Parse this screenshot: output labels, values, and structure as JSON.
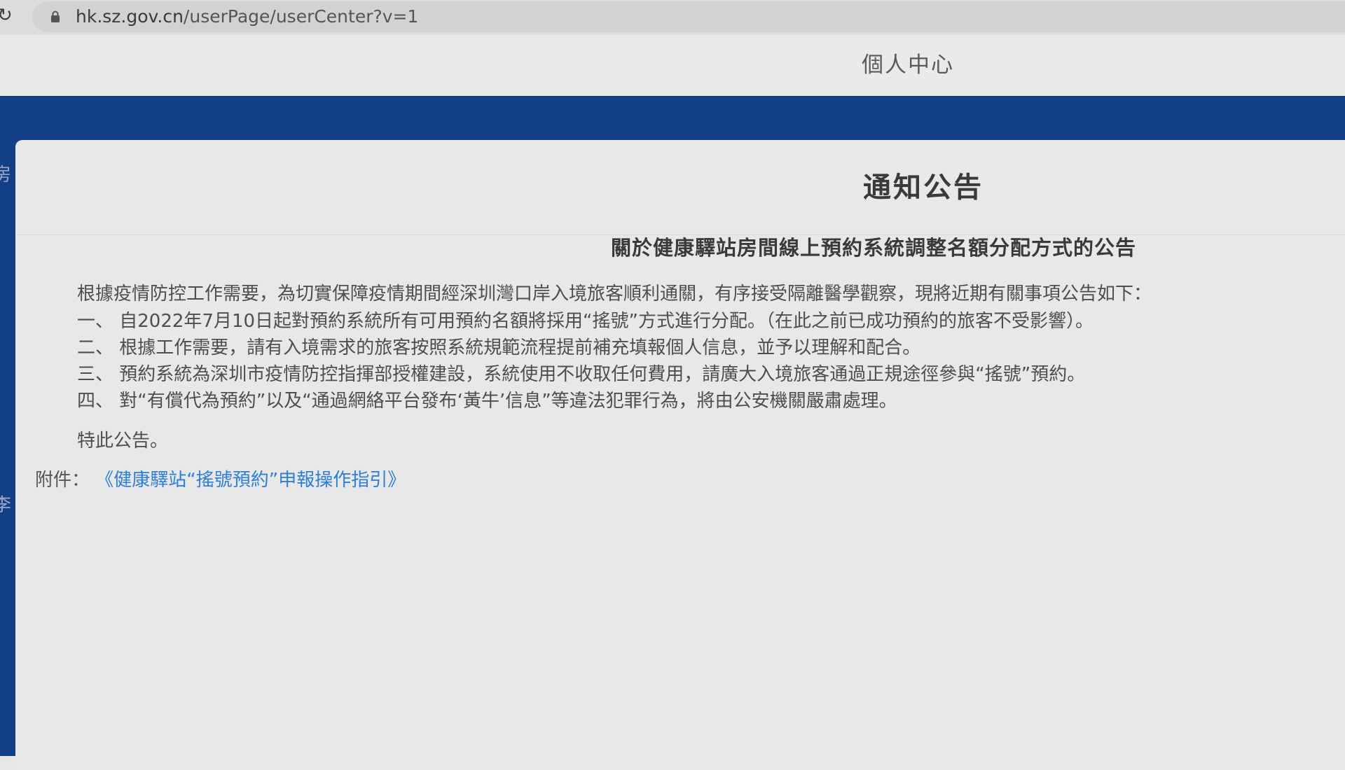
{
  "browser": {
    "url_host": "hk.sz.gov.cn",
    "url_path": "/userPage/userCenter?v=1"
  },
  "header": {
    "title": "個人中心"
  },
  "sidebar": {
    "partial_chars": [
      "房",
      "李"
    ]
  },
  "notice": {
    "section_title": "通知公告",
    "heading": "關於健康驛站房間線上預約系統調整名額分配方式的公告",
    "intro": "根據疫情防控工作需要，為切實保障疫情期間經深圳灣口岸入境旅客順利通關，有序接受隔離醫學觀察，現將近期有關事項公告如下：",
    "items": [
      "一、 自2022年7月10日起對預約系統所有可用預約名額將採用“搖號”方式進行分配。（在此之前已成功預約的旅客不受影響）。",
      "二、 根據工作需要，請有入境需求的旅客按照系統規範流程提前補充填報個人信息，並予以理解和配合。",
      "三、 預約系統為深圳市疫情防控指揮部授權建設，系統使用不收取任何費用，請廣大入境旅客通過正規途徑參與“搖號”預約。",
      "四、 對“有償代為預約”以及“通過網絡平台發布‘黃牛’信息”等違法犯罪行為，將由公安機關嚴肅處理。"
    ],
    "closing": "特此公告。",
    "attachment_label": "附件：",
    "attachment_link": "《健康驛站“搖號預約”申報操作指引》"
  },
  "colors": {
    "nav_band": "#123f85",
    "link": "#2e7fd6"
  }
}
